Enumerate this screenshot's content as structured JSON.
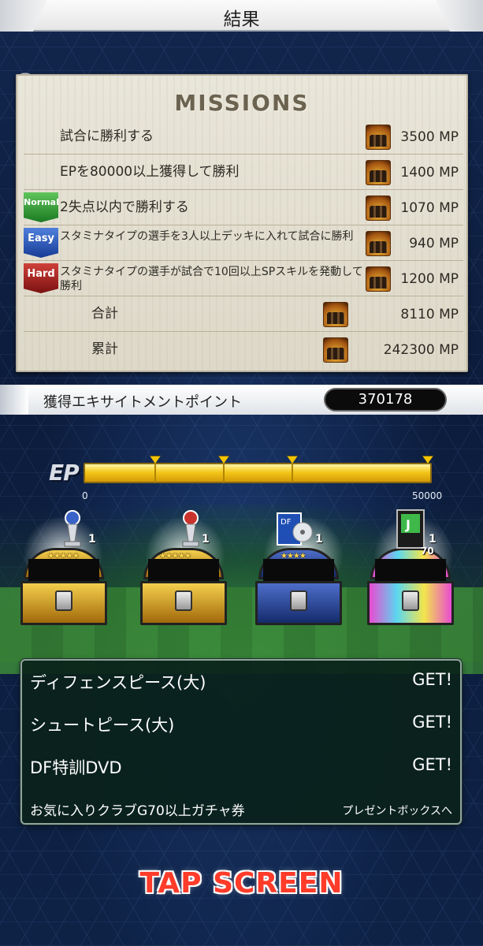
{
  "header": {
    "title": "結果"
  },
  "missions": {
    "title": "MISSIONS",
    "rows": [
      {
        "text": "試合に勝利する",
        "reward": "3500 MP",
        "badge": ""
      },
      {
        "text": "EPを80000以上獲得して勝利",
        "reward": "1400 MP",
        "badge": ""
      },
      {
        "text": "2失点以内で勝利する",
        "reward": "1070 MP",
        "badge": "Normal"
      },
      {
        "text": "スタミナタイプの選手を3人以上デッキに入れて試合に勝利",
        "reward": "940 MP",
        "badge": "Easy"
      },
      {
        "text": "スタミナタイプの選手が試合で10回以上SPスキルを発動して勝利",
        "reward": "1200 MP",
        "badge": "Hard"
      }
    ],
    "total": {
      "label": "合計",
      "value": "8110 MP"
    },
    "cumulative": {
      "label": "累計",
      "value": "242300 MP"
    },
    "icon": "trophy-mp-icon"
  },
  "excitement": {
    "label": "獲得エキサイトメントポイント",
    "value": "370178"
  },
  "ep_gauge": {
    "label": "EP",
    "min_label": "0",
    "max_label": "50000",
    "fill_fraction": 1.0,
    "tick_count": 4
  },
  "chests": [
    {
      "type": "gold",
      "item_icon": "blue-trophy-icon",
      "stars": "★★★★★",
      "count": "1"
    },
    {
      "type": "gold",
      "item_icon": "red-trophy-icon",
      "stars": "★★★★★",
      "count": "1"
    },
    {
      "type": "blue",
      "item_icon": "df-dvd-icon",
      "stars": "★★★★",
      "count": "1"
    },
    {
      "type": "rainbow",
      "item_icon": "j-league-ticket-icon",
      "stars": "",
      "count": "1",
      "sub": "70"
    }
  ],
  "rewards": [
    {
      "name": "ディフェンスピース(大)",
      "status": "GET!"
    },
    {
      "name": "シュートピース(大)",
      "status": "GET!"
    },
    {
      "name": "DF特訓DVD",
      "status": "GET!"
    },
    {
      "name": "お気に入りクラブG70以上ガチャ券",
      "status": "プレゼントボックスへ"
    }
  ],
  "footer": {
    "tap_label": "TAP SCREEN"
  },
  "colors": {
    "background": "#0d1d3d",
    "paper": "#e9e6da",
    "gauge": "#f4c81a",
    "tap": "#ff3b2a",
    "rewards_panel": "#0a221a"
  }
}
